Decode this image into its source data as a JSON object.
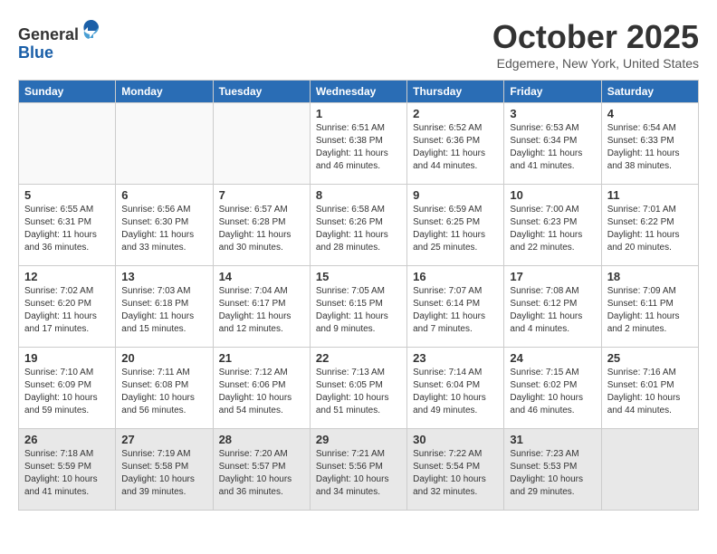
{
  "header": {
    "logo_general": "General",
    "logo_blue": "Blue",
    "month_title": "October 2025",
    "location": "Edgemere, New York, United States"
  },
  "weekdays": [
    "Sunday",
    "Monday",
    "Tuesday",
    "Wednesday",
    "Thursday",
    "Friday",
    "Saturday"
  ],
  "weeks": [
    [
      {
        "day": "",
        "info": ""
      },
      {
        "day": "",
        "info": ""
      },
      {
        "day": "",
        "info": ""
      },
      {
        "day": "1",
        "info": "Sunrise: 6:51 AM\nSunset: 6:38 PM\nDaylight: 11 hours\nand 46 minutes."
      },
      {
        "day": "2",
        "info": "Sunrise: 6:52 AM\nSunset: 6:36 PM\nDaylight: 11 hours\nand 44 minutes."
      },
      {
        "day": "3",
        "info": "Sunrise: 6:53 AM\nSunset: 6:34 PM\nDaylight: 11 hours\nand 41 minutes."
      },
      {
        "day": "4",
        "info": "Sunrise: 6:54 AM\nSunset: 6:33 PM\nDaylight: 11 hours\nand 38 minutes."
      }
    ],
    [
      {
        "day": "5",
        "info": "Sunrise: 6:55 AM\nSunset: 6:31 PM\nDaylight: 11 hours\nand 36 minutes."
      },
      {
        "day": "6",
        "info": "Sunrise: 6:56 AM\nSunset: 6:30 PM\nDaylight: 11 hours\nand 33 minutes."
      },
      {
        "day": "7",
        "info": "Sunrise: 6:57 AM\nSunset: 6:28 PM\nDaylight: 11 hours\nand 30 minutes."
      },
      {
        "day": "8",
        "info": "Sunrise: 6:58 AM\nSunset: 6:26 PM\nDaylight: 11 hours\nand 28 minutes."
      },
      {
        "day": "9",
        "info": "Sunrise: 6:59 AM\nSunset: 6:25 PM\nDaylight: 11 hours\nand 25 minutes."
      },
      {
        "day": "10",
        "info": "Sunrise: 7:00 AM\nSunset: 6:23 PM\nDaylight: 11 hours\nand 22 minutes."
      },
      {
        "day": "11",
        "info": "Sunrise: 7:01 AM\nSunset: 6:22 PM\nDaylight: 11 hours\nand 20 minutes."
      }
    ],
    [
      {
        "day": "12",
        "info": "Sunrise: 7:02 AM\nSunset: 6:20 PM\nDaylight: 11 hours\nand 17 minutes."
      },
      {
        "day": "13",
        "info": "Sunrise: 7:03 AM\nSunset: 6:18 PM\nDaylight: 11 hours\nand 15 minutes."
      },
      {
        "day": "14",
        "info": "Sunrise: 7:04 AM\nSunset: 6:17 PM\nDaylight: 11 hours\nand 12 minutes."
      },
      {
        "day": "15",
        "info": "Sunrise: 7:05 AM\nSunset: 6:15 PM\nDaylight: 11 hours\nand 9 minutes."
      },
      {
        "day": "16",
        "info": "Sunrise: 7:07 AM\nSunset: 6:14 PM\nDaylight: 11 hours\nand 7 minutes."
      },
      {
        "day": "17",
        "info": "Sunrise: 7:08 AM\nSunset: 6:12 PM\nDaylight: 11 hours\nand 4 minutes."
      },
      {
        "day": "18",
        "info": "Sunrise: 7:09 AM\nSunset: 6:11 PM\nDaylight: 11 hours\nand 2 minutes."
      }
    ],
    [
      {
        "day": "19",
        "info": "Sunrise: 7:10 AM\nSunset: 6:09 PM\nDaylight: 10 hours\nand 59 minutes."
      },
      {
        "day": "20",
        "info": "Sunrise: 7:11 AM\nSunset: 6:08 PM\nDaylight: 10 hours\nand 56 minutes."
      },
      {
        "day": "21",
        "info": "Sunrise: 7:12 AM\nSunset: 6:06 PM\nDaylight: 10 hours\nand 54 minutes."
      },
      {
        "day": "22",
        "info": "Sunrise: 7:13 AM\nSunset: 6:05 PM\nDaylight: 10 hours\nand 51 minutes."
      },
      {
        "day": "23",
        "info": "Sunrise: 7:14 AM\nSunset: 6:04 PM\nDaylight: 10 hours\nand 49 minutes."
      },
      {
        "day": "24",
        "info": "Sunrise: 7:15 AM\nSunset: 6:02 PM\nDaylight: 10 hours\nand 46 minutes."
      },
      {
        "day": "25",
        "info": "Sunrise: 7:16 AM\nSunset: 6:01 PM\nDaylight: 10 hours\nand 44 minutes."
      }
    ],
    [
      {
        "day": "26",
        "info": "Sunrise: 7:18 AM\nSunset: 5:59 PM\nDaylight: 10 hours\nand 41 minutes."
      },
      {
        "day": "27",
        "info": "Sunrise: 7:19 AM\nSunset: 5:58 PM\nDaylight: 10 hours\nand 39 minutes."
      },
      {
        "day": "28",
        "info": "Sunrise: 7:20 AM\nSunset: 5:57 PM\nDaylight: 10 hours\nand 36 minutes."
      },
      {
        "day": "29",
        "info": "Sunrise: 7:21 AM\nSunset: 5:56 PM\nDaylight: 10 hours\nand 34 minutes."
      },
      {
        "day": "30",
        "info": "Sunrise: 7:22 AM\nSunset: 5:54 PM\nDaylight: 10 hours\nand 32 minutes."
      },
      {
        "day": "31",
        "info": "Sunrise: 7:23 AM\nSunset: 5:53 PM\nDaylight: 10 hours\nand 29 minutes."
      },
      {
        "day": "",
        "info": ""
      }
    ]
  ]
}
